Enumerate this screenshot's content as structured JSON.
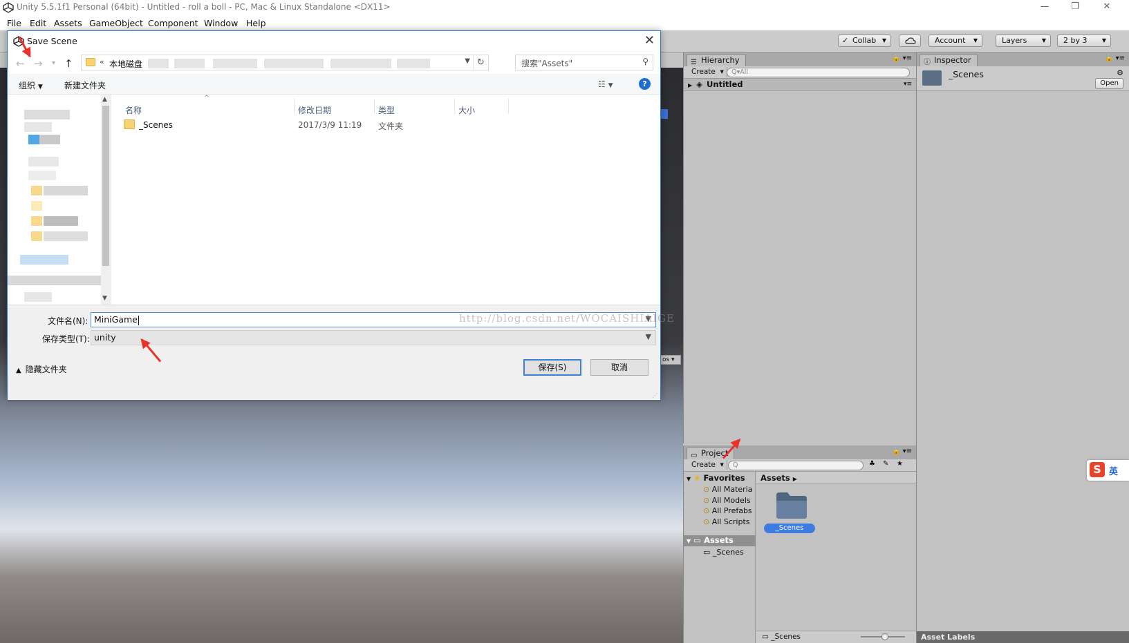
{
  "window": {
    "title": "Unity 5.5.1f1 Personal (64bit) - Untitled - roll a boll - PC, Mac & Linux Standalone <DX11>",
    "minimize": "—",
    "restore": "❐",
    "close": "✕"
  },
  "menu": [
    "File",
    "Edit",
    "Assets",
    "GameObject",
    "Component",
    "Window",
    "Help"
  ],
  "toolbar": {
    "collab": "Collab",
    "account": "Account",
    "layers": "Layers",
    "layout": "2 by 3"
  },
  "hierarchy": {
    "tab": "Hierarchy",
    "create": "Create",
    "search_placeholder": "All",
    "scene": "Untitled"
  },
  "inspector": {
    "tab": "Inspector",
    "name": "_Scenes",
    "open_button": "Open",
    "asset_labels": "Asset Labels"
  },
  "project": {
    "tab": "Project",
    "create": "Create",
    "favorites_label": "Favorites",
    "favorites": [
      "All Materia",
      "All Models",
      "All Prefabs",
      "All Scripts"
    ],
    "assets_label": "Assets",
    "assets_children": [
      "_Scenes"
    ],
    "breadcrumb": "Assets",
    "asset_item": "_Scenes",
    "footer_item": "_Scenes"
  },
  "dialog": {
    "title": "Save Scene",
    "address_prefix": "«",
    "address_path": "本地磁盘",
    "search_placeholder": "搜索\"Assets\"",
    "organize": "组织",
    "new_folder": "新建文件夹",
    "help": "?",
    "columns": [
      "名称",
      "修改日期",
      "类型",
      "大小"
    ],
    "files": [
      {
        "name": "_Scenes",
        "modified": "2017/3/9 11:19",
        "type": "文件夹",
        "size": ""
      }
    ],
    "filename_label": "文件名(N):",
    "filename_value": "MiniGame",
    "filetype_label": "保存类型(T):",
    "filetype_value": "unity",
    "hide_folders": "隐藏文件夹",
    "save_button": "保存(S)",
    "cancel_button": "取消"
  },
  "watermark": "http://blog.csdn.net/WOCAISHIAIGE",
  "ime": {
    "logo": "S",
    "mode": "英"
  },
  "colors": {
    "dialog_border": "#2b79d6",
    "accent_blue": "#3c7fd3",
    "annotation_red": "#e8322b",
    "selected_asset": "#3d7be0"
  }
}
